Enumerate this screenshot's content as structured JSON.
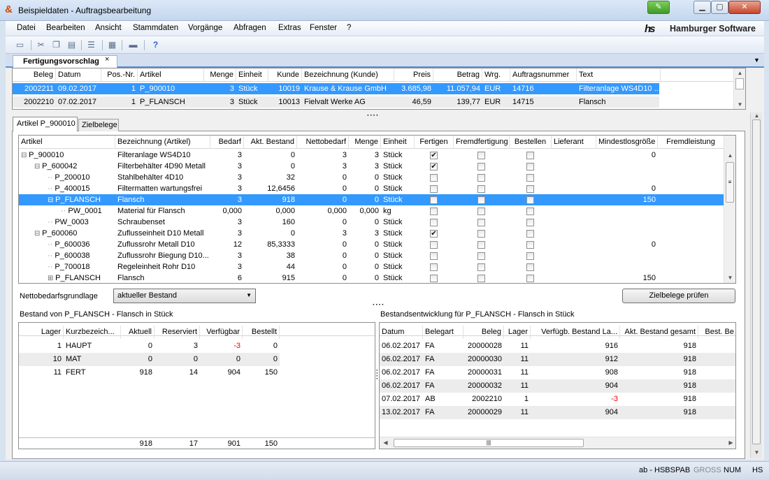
{
  "window": {
    "title": "Beispieldaten - Auftragsbearbeitung",
    "app_icon": "app-logo-icon"
  },
  "menu": [
    "Datei",
    "Bearbeiten",
    "Ansicht",
    "Stammdaten",
    "Vorgänge",
    "Abfragen",
    "Extras",
    "Fenster",
    "?"
  ],
  "brand": {
    "logo": "hs",
    "name": "Hamburger Software"
  },
  "toolbar_icons": [
    "open-folder-icon",
    "cut-icon",
    "copy-icon",
    "paste-icon",
    "list-view-icon",
    "properties-icon",
    "window-icon",
    "help-icon"
  ],
  "doc_tab": {
    "label": "Fertigungsvorschlag",
    "close": "×"
  },
  "orders": {
    "columns": [
      "Beleg",
      "Datum",
      "Pos.-Nr.",
      "Artikel",
      "Menge",
      "Einheit",
      "Kunde",
      "Bezeichnung (Kunde)",
      "Preis",
      "Betrag",
      "Wrg.",
      "Auftragsnummer",
      "Text"
    ],
    "rows": [
      {
        "beleg": "2002211",
        "datum": "09.02.2017",
        "pos": "1",
        "artikel": "P_900010",
        "menge": "3",
        "einheit": "Stück",
        "kunde": "10019",
        "bezeichnung": "Krause & Krause GmbH",
        "preis": "3.685,98",
        "betrag": "11.057,94",
        "wrg": "EUR",
        "auftrag": "14716",
        "text": "Filteranlage WS4D10 ...",
        "selected": true
      },
      {
        "beleg": "2002210",
        "datum": "07.02.2017",
        "pos": "1",
        "artikel": "P_FLANSCH",
        "menge": "3",
        "einheit": "Stück",
        "kunde": "10013",
        "bezeichnung": "Fielvalt Werke AG",
        "preis": "46,59",
        "betrag": "139,77",
        "wrg": "EUR",
        "auftrag": "14715",
        "text": "Flansch",
        "selected": false
      }
    ]
  },
  "tabs": {
    "artikel": "Artikel P_900010",
    "zielbelege": "Zielbelege"
  },
  "tree": {
    "columns": [
      "Artikel",
      "Bezeichnung (Artikel)",
      "Bedarf",
      "Akt. Bestand",
      "Nettobedarf",
      "Menge",
      "Einheit",
      "Fertigen",
      "Fremdfertigung",
      "Bestellen",
      "Lieferant",
      "Mindestlosgröße",
      "Fremdleistung"
    ],
    "rows": [
      {
        "level": 0,
        "prefix": "⊟",
        "artikel": "P_900010",
        "bez": "Filteranlage WS4D10",
        "bedarf": "3",
        "bestand": "0",
        "netto": "3",
        "menge": "3",
        "einheit": "Stück",
        "fertigen": true,
        "fremd": false,
        "bestellen": false,
        "mindest": "0"
      },
      {
        "level": 1,
        "prefix": "⊟",
        "artikel": "P_600042",
        "bez": "Filterbehälter 4D90 Metall",
        "bedarf": "3",
        "bestand": "0",
        "netto": "3",
        "menge": "3",
        "einheit": "Stück",
        "fertigen": true,
        "fremd": false,
        "bestellen": false,
        "mindest": ""
      },
      {
        "level": 2,
        "prefix": "",
        "artikel": "P_200010",
        "bez": "Stahlbehälter 4D10",
        "bedarf": "3",
        "bestand": "32",
        "netto": "0",
        "menge": "0",
        "einheit": "Stück",
        "fertigen": false,
        "fremd": false,
        "bestellen": false,
        "mindest": ""
      },
      {
        "level": 2,
        "prefix": "",
        "artikel": "P_400015",
        "bez": "Filtermatten wartungsfrei",
        "bedarf": "3",
        "bestand": "12,6456",
        "netto": "0",
        "menge": "0",
        "einheit": "Stück",
        "fertigen": false,
        "fremd": false,
        "bestellen": false,
        "mindest": "0"
      },
      {
        "level": 2,
        "prefix": "⊟",
        "artikel": "P_FLANSCH",
        "bez": "Flansch",
        "bedarf": "3",
        "bestand": "918",
        "netto": "0",
        "menge": "0",
        "einheit": "Stück",
        "fertigen": false,
        "fremd": false,
        "bestellen": false,
        "mindest": "150",
        "selected": true
      },
      {
        "level": 3,
        "prefix": "",
        "artikel": "PW_0001",
        "bez": "Material für Flansch",
        "bedarf": "0,000",
        "bestand": "0,000",
        "netto": "0,000",
        "menge": "0,000",
        "einheit": "kg",
        "fertigen": false,
        "fremd": false,
        "bestellen": false,
        "mindest": ""
      },
      {
        "level": 2,
        "prefix": "",
        "artikel": "PW_0003",
        "bez": "Schraubenset",
        "bedarf": "3",
        "bestand": "160",
        "netto": "0",
        "menge": "0",
        "einheit": "Stück",
        "fertigen": false,
        "fremd": false,
        "bestellen": false,
        "mindest": ""
      },
      {
        "level": 1,
        "prefix": "⊟",
        "artikel": "P_600060",
        "bez": "Zuflusseinheit D10 Metall",
        "bedarf": "3",
        "bestand": "0",
        "netto": "3",
        "menge": "3",
        "einheit": "Stück",
        "fertigen": true,
        "fremd": false,
        "bestellen": false,
        "mindest": ""
      },
      {
        "level": 2,
        "prefix": "",
        "artikel": "P_600036",
        "bez": "Zuflussrohr Metall D10",
        "bedarf": "12",
        "bestand": "85,3333",
        "netto": "0",
        "menge": "0",
        "einheit": "Stück",
        "fertigen": false,
        "fremd": false,
        "bestellen": false,
        "mindest": "0"
      },
      {
        "level": 2,
        "prefix": "",
        "artikel": "P_600038",
        "bez": "Zuflussrohr Biegung D10...",
        "bedarf": "3",
        "bestand": "38",
        "netto": "0",
        "menge": "0",
        "einheit": "Stück",
        "fertigen": false,
        "fremd": false,
        "bestellen": false,
        "mindest": ""
      },
      {
        "level": 2,
        "prefix": "",
        "artikel": "P_700018",
        "bez": "Regeleinheit Rohr D10",
        "bedarf": "3",
        "bestand": "44",
        "netto": "0",
        "menge": "0",
        "einheit": "Stück",
        "fertigen": false,
        "fremd": false,
        "bestellen": false,
        "mindest": ""
      },
      {
        "level": 2,
        "prefix": "⊞",
        "artikel": "P_FLANSCH",
        "bez": "Flansch",
        "bedarf": "6",
        "bestand": "915",
        "netto": "0",
        "menge": "0",
        "einheit": "Stück",
        "fertigen": false,
        "fremd": false,
        "bestellen": false,
        "mindest": "150"
      }
    ]
  },
  "nettobedarf": {
    "label": "Nettobedarfsgrundlage",
    "value": "aktueller Bestand"
  },
  "zielbelege_button": "Zielbelege prüfen",
  "bestand": {
    "title": "Bestand von P_FLANSCH - Flansch in Stück",
    "columns": [
      "Lager",
      "Kurzbezeich...",
      "Aktuell",
      "Reserviert",
      "Verfügbar",
      "Bestellt"
    ],
    "rows": [
      {
        "lager": "1",
        "kurz": "HAUPT",
        "aktuell": "0",
        "reserviert": "3",
        "verfuegbar": "-3",
        "bestellt": "0",
        "neg": true
      },
      {
        "lager": "10",
        "kurz": "MAT",
        "aktuell": "0",
        "reserviert": "0",
        "verfuegbar": "0",
        "bestellt": "0",
        "neg": false
      },
      {
        "lager": "11",
        "kurz": "FERT",
        "aktuell": "918",
        "reserviert": "14",
        "verfuegbar": "904",
        "bestellt": "150",
        "neg": false
      }
    ],
    "totals": {
      "aktuell": "918",
      "reserviert": "17",
      "verfuegbar": "901",
      "bestellt": "150"
    }
  },
  "entwicklung": {
    "title": "Bestandsentwicklung für P_FLANSCH - Flansch in Stück",
    "columns": [
      "Datum",
      "Belegart",
      "Beleg",
      "Lager",
      "Verfügb. Bestand La...",
      "Akt. Bestand gesamt",
      "Best. Be"
    ],
    "rows": [
      {
        "datum": "06.02.2017",
        "art": "FA",
        "beleg": "20000028",
        "lager": "11",
        "verf": "916",
        "akt": "918",
        "neg": false
      },
      {
        "datum": "06.02.2017",
        "art": "FA",
        "beleg": "20000030",
        "lager": "11",
        "verf": "912",
        "akt": "918",
        "neg": false
      },
      {
        "datum": "06.02.2017",
        "art": "FA",
        "beleg": "20000031",
        "lager": "11",
        "verf": "908",
        "akt": "918",
        "neg": false
      },
      {
        "datum": "06.02.2017",
        "art": "FA",
        "beleg": "20000032",
        "lager": "11",
        "verf": "904",
        "akt": "918",
        "neg": false
      },
      {
        "datum": "07.02.2017",
        "art": "AB",
        "beleg": "2002210",
        "lager": "1",
        "verf": "-3",
        "akt": "918",
        "neg": true
      },
      {
        "datum": "13.02.2017",
        "art": "FA",
        "beleg": "20000029",
        "lager": "11",
        "verf": "904",
        "akt": "918",
        "neg": false
      }
    ]
  },
  "statusbar": {
    "user": "ab - HSBSPAB",
    "gross": "GROSS",
    "num": "NUM",
    "hs": "HS"
  },
  "colors": {
    "selection": "#3399ff",
    "negative": "#e00000",
    "titlebar": "#c4d7ee"
  }
}
